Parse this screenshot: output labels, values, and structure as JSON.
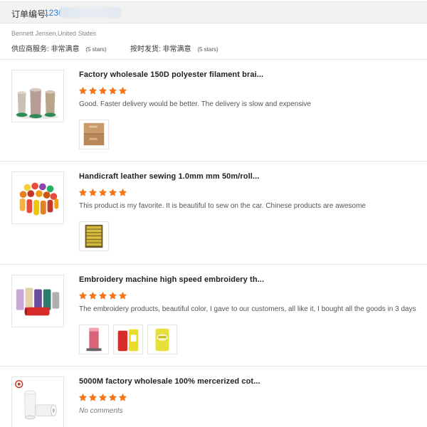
{
  "order": {
    "label": "订单编号:",
    "number": "1236"
  },
  "buyer": {
    "name": "Bennett Jensen,United States"
  },
  "ratings": {
    "supplier_label": "供应商服务:",
    "supplier_value": "非常满意",
    "supplier_stars": "(5 stars)",
    "shipping_label": "按时发货:",
    "shipping_value": "非常满意",
    "shipping_stars": "(5 stars)"
  },
  "colors": {
    "star": "#f2751a",
    "link": "#2a7bd4"
  },
  "reviews": [
    {
      "title": "Factory wholesale 150D polyester filament brai...",
      "rating": 5,
      "comment": "Good. Faster delivery would be better. The delivery is slow and expensive",
      "photo_count": 1
    },
    {
      "title": "Handicraft leather sewing 1.0mm mm 50m/roll...",
      "rating": 5,
      "comment": "This product is my favorite. It is beautiful to sew on the car. Chinese products are awesome",
      "photo_count": 1
    },
    {
      "title": "Embroidery machine high speed embroidery th...",
      "rating": 5,
      "comment": "The embroidery products, beautiful color, I gave to our customers, all like it, I bought all the goods in 3 days",
      "photo_count": 3
    },
    {
      "title": "5000M factory wholesale 100% mercerized cot...",
      "rating": 5,
      "comment": "No comments",
      "photo_count": 0
    }
  ]
}
